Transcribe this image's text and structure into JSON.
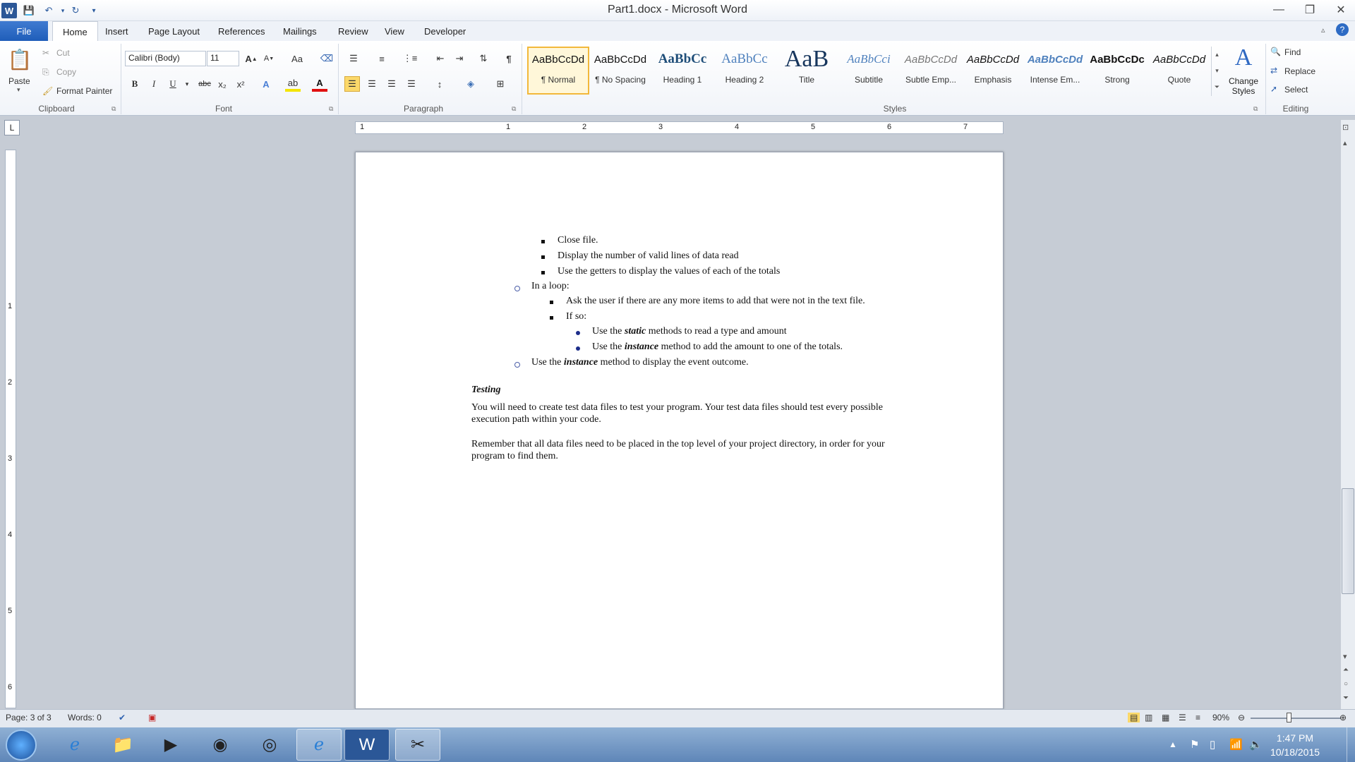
{
  "window": {
    "title": "Part1.docx - Microsoft Word",
    "app_icon": "W"
  },
  "tabs": [
    {
      "label": "File"
    },
    {
      "label": "Home"
    },
    {
      "label": "Insert"
    },
    {
      "label": "Page Layout"
    },
    {
      "label": "References"
    },
    {
      "label": "Mailings"
    },
    {
      "label": "Review"
    },
    {
      "label": "View"
    },
    {
      "label": "Developer"
    }
  ],
  "clipboard": {
    "paste": "Paste",
    "cut": "Cut",
    "copy": "Copy",
    "format_painter": "Format Painter",
    "label": "Clipboard"
  },
  "font": {
    "family": "Calibri (Body)",
    "size": "11",
    "label": "Font",
    "change_case": "Aa",
    "bold": "B",
    "italic": "I",
    "underline": "U",
    "strike": "abc",
    "subscript": "x₂",
    "superscript": "x²"
  },
  "paragraph": {
    "label": "Paragraph"
  },
  "styles": {
    "label": "Styles",
    "items": [
      {
        "sample": "AaBbCcDd",
        "name": "¶ Normal"
      },
      {
        "sample": "AaBbCcDd",
        "name": "¶ No Spacing"
      },
      {
        "sample": "AaBbCc",
        "name": "Heading 1"
      },
      {
        "sample": "AaBbCc",
        "name": "Heading 2"
      },
      {
        "sample": "AaB",
        "name": "Title"
      },
      {
        "sample": "AaBbCci",
        "name": "Subtitle"
      },
      {
        "sample": "AaBbCcDd",
        "name": "Subtle Emp..."
      },
      {
        "sample": "AaBbCcDd",
        "name": "Emphasis"
      },
      {
        "sample": "AaBbCcDd",
        "name": "Intense Em..."
      },
      {
        "sample": "AaBbCcDc",
        "name": "Strong"
      },
      {
        "sample": "AaBbCcDd",
        "name": "Quote"
      }
    ],
    "change_styles": "Change Styles"
  },
  "editing": {
    "label": "Editing",
    "find": "Find",
    "replace": "Replace",
    "select": "Select"
  },
  "ruler": {
    "numbers": [
      "1",
      "1",
      "2",
      "3",
      "4",
      "5",
      "6",
      "7"
    ]
  },
  "vruler": {
    "numbers": [
      "1",
      "2",
      "3",
      "4",
      "5",
      "6"
    ]
  },
  "document": {
    "l3a": "Close file.",
    "l3b": "Display the number of valid lines of data read",
    "l3c": "Use the getters to display the values of each of the totals",
    "loop": "In a loop:",
    "ask": "Ask the user if there are any more items to add that were not in the text file.",
    "ifso": "If so:",
    "static_pre": "Use the ",
    "static_word": "static",
    "static_post": " methods to read a type and amount",
    "inst1_pre": "Use the ",
    "inst1_word": "instance",
    "inst1_post": " method to add the amount to one of the totals.",
    "inst2_pre": "Use the ",
    "inst2_word": "instance",
    "inst2_post": " method to display the event outcome.",
    "heading": "Testing",
    "para1a": "You will need to create test data files to test your program.  Your test data files should test every possible",
    "para1b": "execution path within your code.",
    "para2a": "Remember that all data files need to be placed in the top level of your project directory, in order for your",
    "para2b": "program to find them."
  },
  "status": {
    "page": "Page: 3 of 3",
    "words": "Words: 0",
    "zoom": "90%"
  },
  "taskbar": {
    "time": "1:47 PM",
    "date": "10/18/2015"
  }
}
